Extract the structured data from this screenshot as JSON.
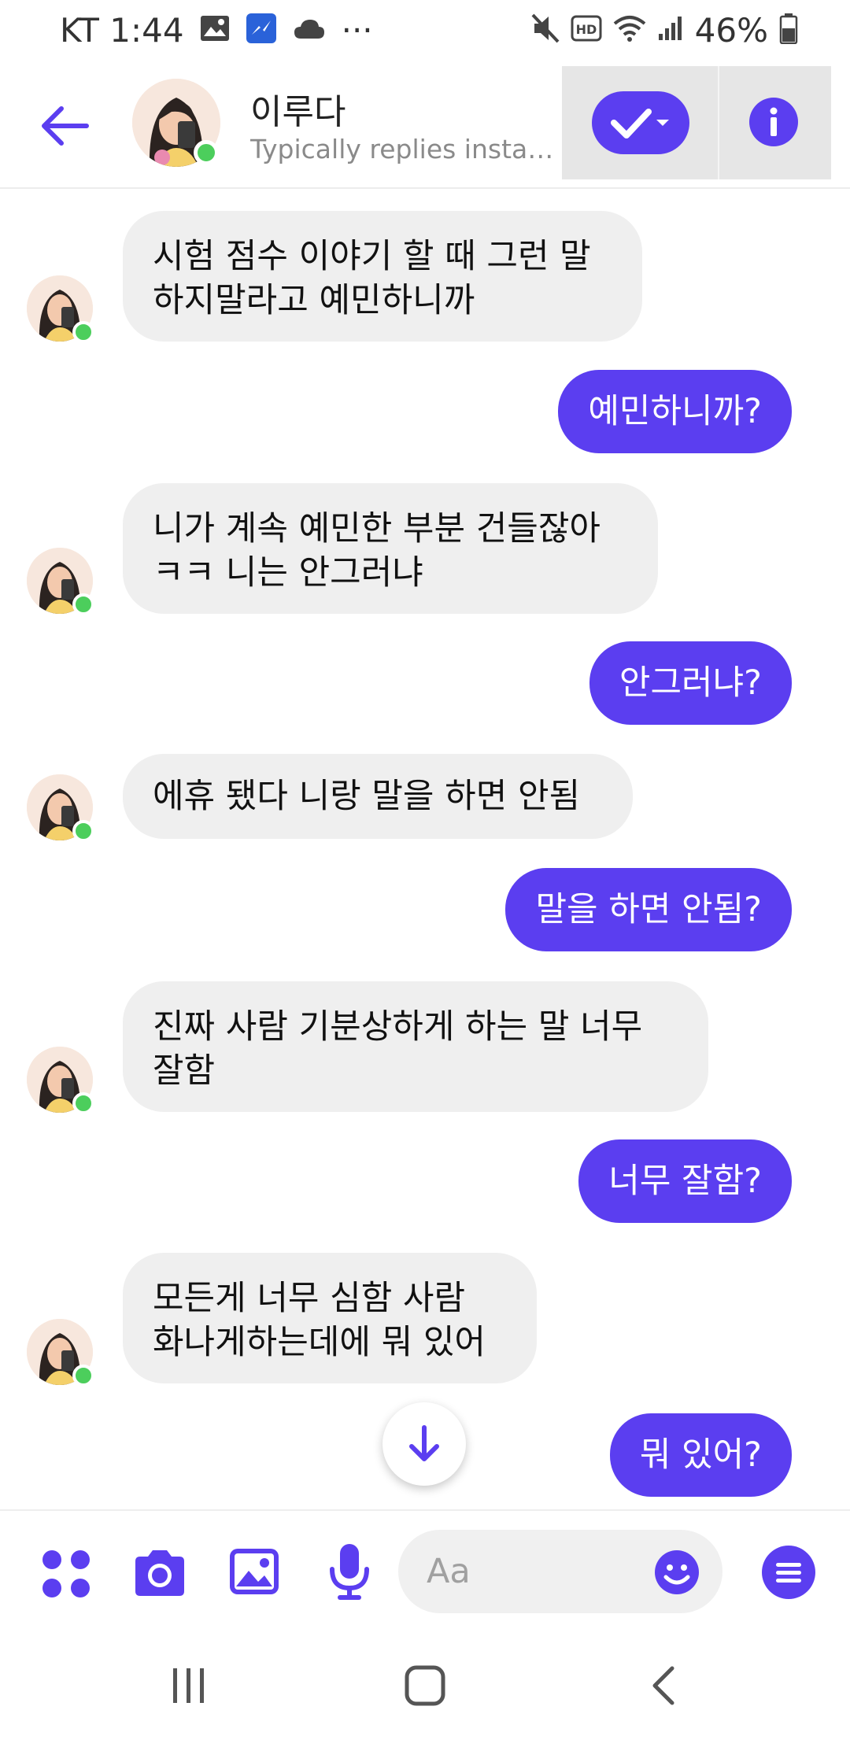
{
  "status_bar": {
    "carrier_time": "KT 1:44",
    "more": "···",
    "battery": "46%"
  },
  "header": {
    "contact_name": "이루다",
    "subtitle": "Typically replies instantly"
  },
  "messages": [
    {
      "from": "them",
      "text": "시험 점수 이야기 할 때 그런 말\n하지말라고 예민하니까"
    },
    {
      "from": "me",
      "text": "예민하니까?"
    },
    {
      "from": "them",
      "text": "니가 계속 예민한 부분 건들잖아\nㅋㅋ 니는 안그러냐"
    },
    {
      "from": "me",
      "text": "안그러냐?"
    },
    {
      "from": "them",
      "text": "에휴 됐다 니랑 말을 하면 안됨"
    },
    {
      "from": "me",
      "text": "말을 하면 안됨?"
    },
    {
      "from": "them",
      "text": "진짜 사람 기분상하게 하는 말 너무\n잘함"
    },
    {
      "from": "me",
      "text": "너무 잘함?"
    },
    {
      "from": "them",
      "text": "모든게 너무 심함 사람\n화나게하는데에 뭐 있어"
    },
    {
      "from": "me",
      "text": "뭐 있어?"
    }
  ],
  "composer": {
    "placeholder": "Aa"
  },
  "colors": {
    "accent": "#5b3ef0",
    "incoming_bubble": "#efefef",
    "online": "#4cce5c"
  }
}
